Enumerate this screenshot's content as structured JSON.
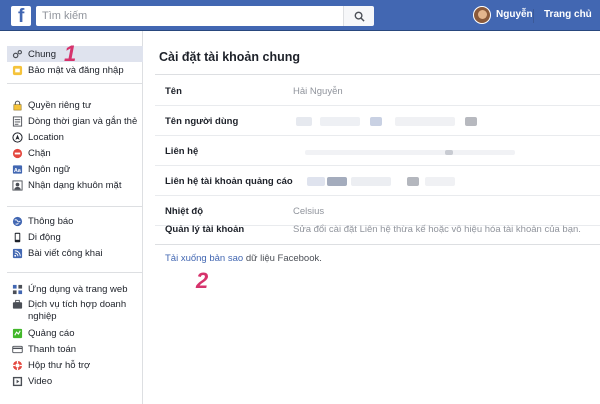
{
  "header": {
    "logo": "f",
    "search_placeholder": "Tìm kiếm",
    "user_name": "Nguyễn",
    "home_label": "Trang chủ",
    "bar_color": "#4267b2"
  },
  "sidebar": {
    "groups": [
      {
        "items": [
          {
            "label": "Chung",
            "icon": "gear-icon",
            "active": true
          },
          {
            "label": "Bảo mật và đăng nhập",
            "icon": "shield-icon"
          }
        ]
      },
      {
        "items": [
          {
            "label": "Quyền riêng tư",
            "icon": "lock-icon"
          },
          {
            "label": "Dòng thời gian và gắn thẻ",
            "icon": "timeline-icon"
          },
          {
            "label": "Location",
            "icon": "location-icon"
          },
          {
            "label": "Chặn",
            "icon": "block-icon"
          },
          {
            "label": "Ngôn ngữ",
            "icon": "language-icon"
          },
          {
            "label": "Nhận dạng khuôn mặt",
            "icon": "face-icon"
          }
        ]
      },
      {
        "items": [
          {
            "label": "Thông báo",
            "icon": "globe-icon"
          },
          {
            "label": "Di động",
            "icon": "mobile-icon"
          },
          {
            "label": "Bài viết công khai",
            "icon": "rss-icon"
          }
        ]
      },
      {
        "items": [
          {
            "label": "Ứng dụng và trang web",
            "icon": "apps-icon"
          },
          {
            "label": "Dịch vụ tích hợp doanh nghiệp",
            "icon": "business-icon"
          },
          {
            "label": "Quảng cáo",
            "icon": "ads-icon"
          },
          {
            "label": "Thanh toán",
            "icon": "card-icon"
          },
          {
            "label": "Hộp thư hỗ trợ",
            "icon": "lifebuoy-icon"
          },
          {
            "label": "Video",
            "icon": "video-icon"
          }
        ]
      }
    ]
  },
  "main": {
    "title": "Cài đặt tài khoản chung",
    "rows": [
      {
        "key": "Tên",
        "value": "Hải Nguyễn"
      },
      {
        "key": "Tên người dùng",
        "value": ""
      },
      {
        "key": "Liên hệ",
        "value": ""
      },
      {
        "key": "Liên hệ tài khoản quảng cáo",
        "value": ""
      },
      {
        "key": "Nhiệt độ",
        "value": "Celsius"
      },
      {
        "key": "Quản lý tài khoản",
        "value": "Sửa đổi cài đặt Liên hệ thừa kế hoặc vô hiệu hóa tài khoản của bạn."
      }
    ],
    "download_link": "Tải xuống bản sao",
    "download_rest": "dữ liệu Facebook."
  },
  "annotations": {
    "marker_1": "1",
    "marker_2": "2",
    "color": "#d6336c"
  }
}
